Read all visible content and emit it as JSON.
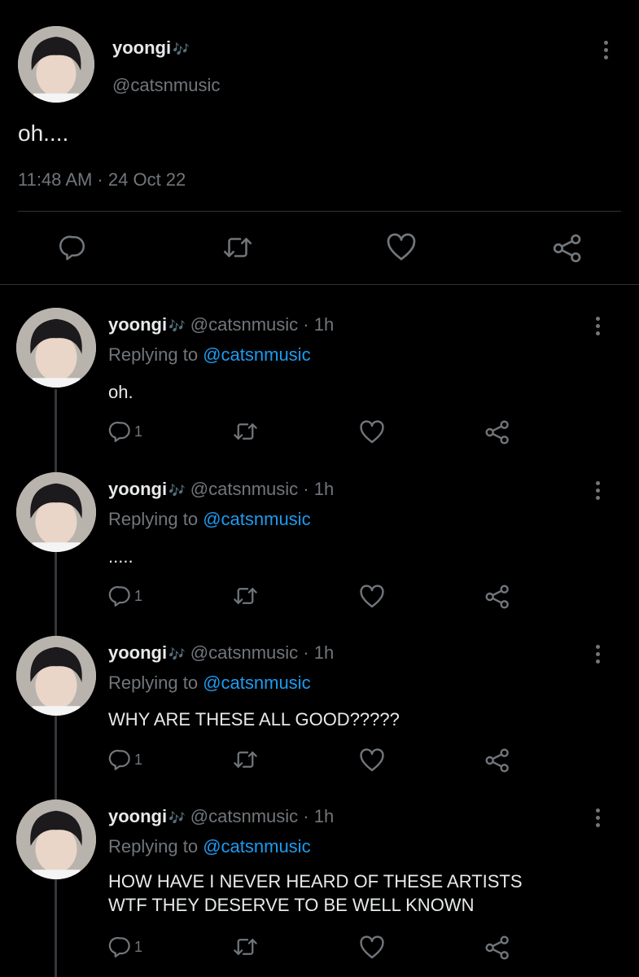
{
  "main_tweet": {
    "display_name": "yoongi",
    "name_emoji": "🎶",
    "handle": "@catsnmusic",
    "text": "oh....",
    "timestamp": "11:48 AM · 24 Oct 22"
  },
  "replies": [
    {
      "display_name": "yoongi",
      "name_emoji": "🎶",
      "handle": "@catsnmusic",
      "time": "· 1h",
      "replying_prefix": "Replying to",
      "replying_handle": "@catsnmusic",
      "lines": [
        "oh."
      ],
      "reply_count": "1"
    },
    {
      "display_name": "yoongi",
      "name_emoji": "🎶",
      "handle": "@catsnmusic",
      "time": "· 1h",
      "replying_prefix": "Replying to",
      "replying_handle": "@catsnmusic",
      "lines": [
        "....."
      ],
      "reply_count": "1"
    },
    {
      "display_name": "yoongi",
      "name_emoji": "🎶",
      "handle": "@catsnmusic",
      "time": "· 1h",
      "replying_prefix": "Replying to",
      "replying_handle": "@catsnmusic",
      "lines": [
        "WHY ARE THESE ALL GOOD?????"
      ],
      "reply_count": "1"
    },
    {
      "display_name": "yoongi",
      "name_emoji": "🎶",
      "handle": "@catsnmusic",
      "time": "· 1h",
      "replying_prefix": "Replying to",
      "replying_handle": "@catsnmusic",
      "lines": [
        "HOW HAVE I NEVER HEARD OF THESE ARTISTS",
        "WTF THEY DESERVE TO BE WELL KNOWN"
      ],
      "reply_count": "1"
    }
  ],
  "icons": {
    "reply": "speech-bubble-icon",
    "retweet": "retweet-arrows-icon",
    "like": "heart-icon",
    "share": "share-nodes-icon",
    "more": "vertical-dots-icon"
  },
  "colors": {
    "background": "#000000",
    "text": "#e7e9ea",
    "muted": "#71767b",
    "link": "#1d9bf0",
    "divider": "#2f3336"
  }
}
